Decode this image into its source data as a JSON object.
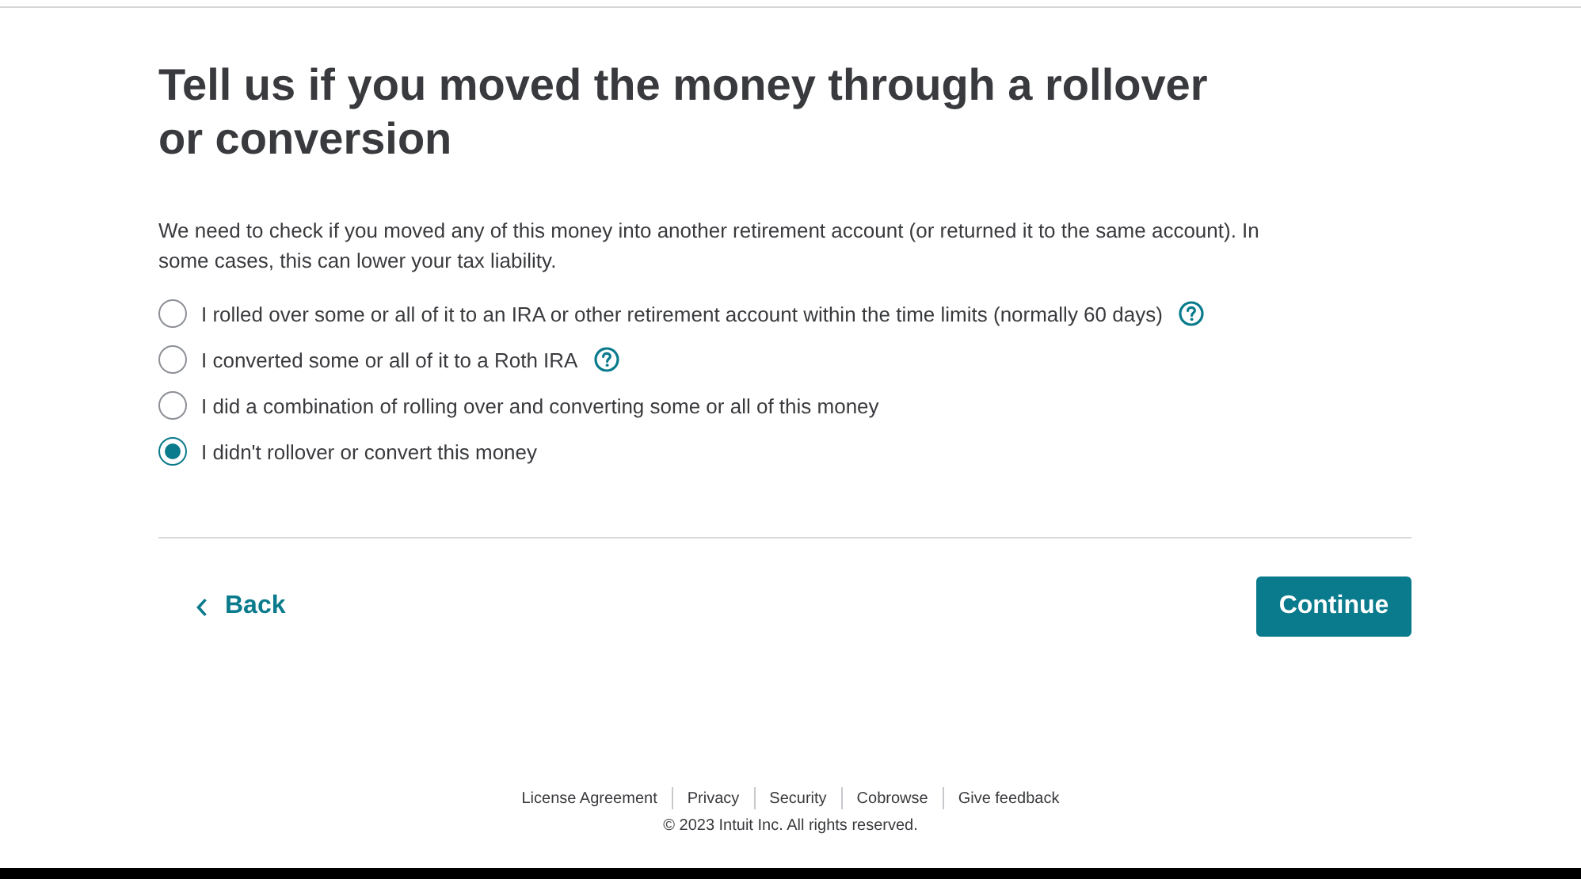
{
  "title": "Tell us if you moved the money through a rollover or conversion",
  "description": "We need to check if you moved any of this money into another retirement account (or returned it to the same account). In some cases, this can lower your tax liability.",
  "options": [
    {
      "label": "I rolled over some or all of it to an IRA or other retirement account within the time limits (normally 60 days)",
      "selected": false,
      "help": true
    },
    {
      "label": "I converted some or all of it to a Roth IRA",
      "selected": false,
      "help": true
    },
    {
      "label": "I did a combination of rolling over and converting some or all of this money",
      "selected": false,
      "help": false
    },
    {
      "label": "I didn't rollover or convert this money",
      "selected": true,
      "help": false
    }
  ],
  "back_button": "Back",
  "continue_button": "Continue",
  "footer": {
    "links": [
      "License Agreement",
      "Privacy",
      "Security",
      "Cobrowse",
      "Give feedback"
    ],
    "copyright": "© 2023 Intuit Inc. All rights reserved."
  }
}
